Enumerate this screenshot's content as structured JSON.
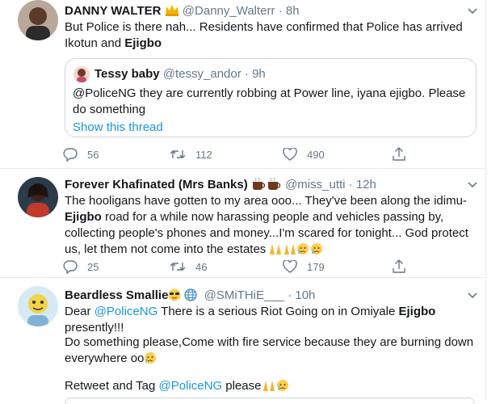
{
  "tweets": [
    {
      "name": "DANNY WALTER",
      "badge_icon": "crown-emoji",
      "handle": "@Danny_Walterr",
      "sep": "·",
      "time": "8h",
      "text_before": "But Police is there nah... Residents have confirmed that Police has arrived Ikotun and ",
      "text_highlight": "Ejigbo",
      "quote": {
        "name": "Tessy baby",
        "handle": "@tessy_andor",
        "sep": "·",
        "time": "9h",
        "text": "@PoliceNG they are currently robbing at Power line, iyana ejigbo. Please do something",
        "show_thread": "Show this thread"
      },
      "replies": "56",
      "retweets": "112",
      "likes": "490"
    },
    {
      "name": "Forever Khafinated (Mrs Banks)",
      "badge_icon": "coffee-emoji",
      "handle": "@miss_utti",
      "sep": "·",
      "time": "12h",
      "text_1": "The hooligans have gotten to my area ooo... They've been along the idimu-",
      "text_highlight": "Ejigbo",
      "text_2": " road for a while now harassing people and vehicles passing by, collecting people's phones and money...I'm scared for tonight... God protect us, let them not come into the estates",
      "trailing_emoji": "praying-hands-and-crying-emoji",
      "replies": "25",
      "retweets": "46",
      "likes": "179"
    },
    {
      "name": "Beardless Smallie",
      "badge_icon": "sunglasses-globe-emoji",
      "handle": "@SMiTHiE___",
      "sep": "·",
      "time": "10h",
      "p1_a": "Dear ",
      "p1_mention": "@PoliceNG",
      "p1_b": " There is a serious Riot Going on in Omiyale ",
      "p1_highlight": "Ejigbo",
      "p1_c": " presently!!!",
      "p2": "Do something please,Come with fire service because they are burning down everywhere oo",
      "p3_a": "Retweet and Tag ",
      "p3_mention": "@PoliceNG",
      "p3_b": " please"
    }
  ],
  "colors": {
    "text": "#14171a",
    "secondary": "#657786",
    "link": "#1b95e0",
    "divider": "#e6ecf0"
  }
}
